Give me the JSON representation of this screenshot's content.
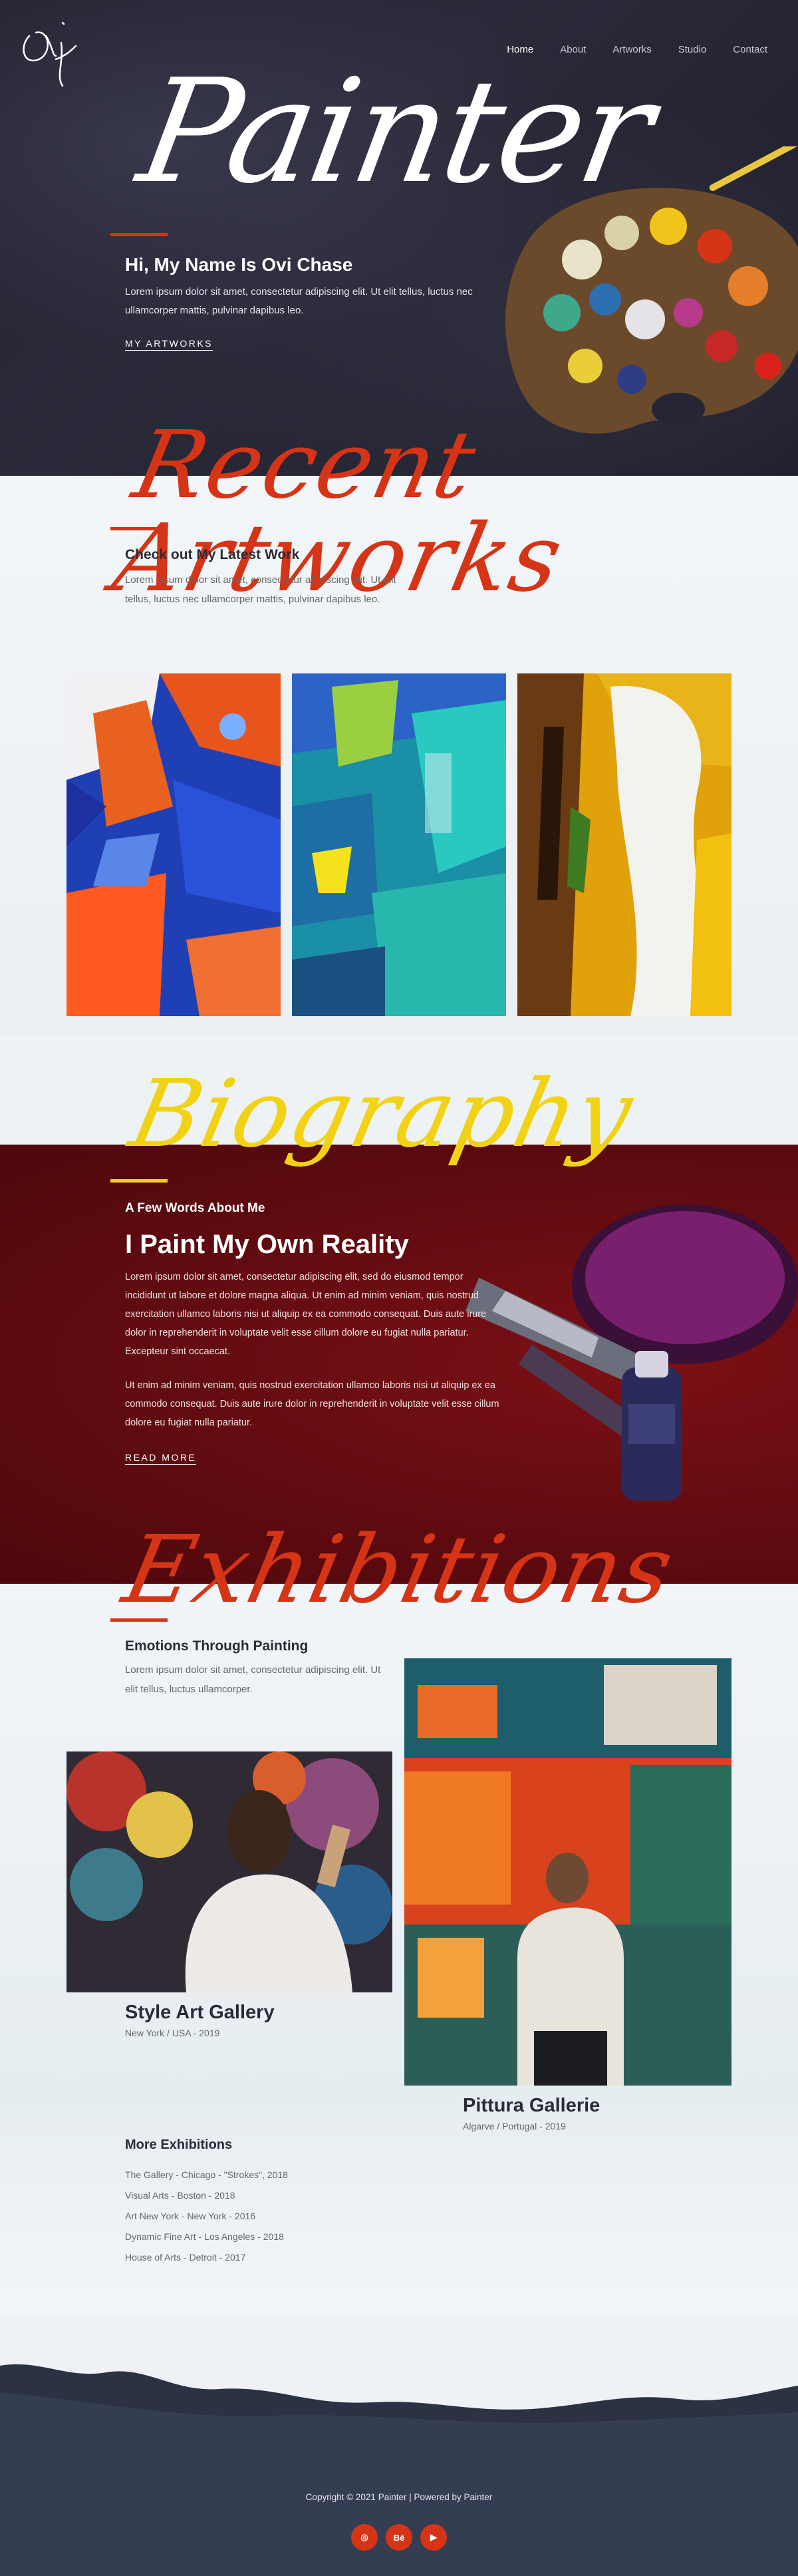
{
  "nav": {
    "items": [
      {
        "label": "Home",
        "active": true
      },
      {
        "label": "About",
        "active": false
      },
      {
        "label": "Artworks",
        "active": false
      },
      {
        "label": "Studio",
        "active": false
      },
      {
        "label": "Contact",
        "active": false
      }
    ]
  },
  "hero": {
    "script_title": "Painter",
    "greeting": "Hi, My Name Is Ovi Chase",
    "text": "Lorem ipsum dolor sit amet, consectetur adipiscing elit. Ut elit tellus, luctus nec ullamcorper mattis, pulvinar dapibus leo.",
    "link_label": "MY ARTWORKS"
  },
  "recent": {
    "script_title": "Recent Artworks",
    "subtitle": "Check out My Latest Work",
    "text": "Lorem ipsum dolor sit amet, consectetur adipiscing elit. Ut elit tellus, luctus nec ullamcorper mattis, pulvinar dapibus leo."
  },
  "biography": {
    "script_title": "Biography",
    "subtitle": "A Few Words About Me",
    "title": "I Paint My Own Reality",
    "paragraph1": "Lorem ipsum dolor sit amet, consectetur adipiscing elit, sed do eiusmod tempor incididunt ut labore et dolore magna aliqua. Ut enim ad minim veniam, quis nostrud exercitation ullamco laboris nisi ut aliquip ex ea commodo consequat. Duis aute irure dolor in reprehenderit in voluptate velit esse cillum dolore eu fugiat nulla pariatur. Excepteur sint occaecat.",
    "paragraph2": "Ut enim ad minim veniam, quis nostrud exercitation ullamco laboris nisi ut aliquip ex ea commodo consequat. Duis aute irure dolor in reprehenderit in voluptate velit esse cillum dolore eu fugiat nulla pariatur.",
    "link_label": "READ MORE"
  },
  "exhibitions": {
    "script_title": "Exhibitions",
    "subtitle": "Emotions Through Painting",
    "text": "Lorem ipsum dolor sit amet, consectetur adipiscing elit. Ut elit tellus, luctus ullamcorper.",
    "gallery1": {
      "name": "Style Art Gallery",
      "location": "New York / USA - 2019"
    },
    "gallery2": {
      "name": "Pittura Gallerie",
      "location": "Algarve / Portugal - 2019"
    },
    "more_title": "More Exhibitions",
    "more_items": [
      "The Gallery - Chicago - \"Strokes\", 2018",
      "Visual Arts - Boston - 2018",
      "Art New York - New York - 2016",
      "Dynamic Fine Art - Los Angeles - 2018",
      "House of Arts - Detroit - 2017"
    ]
  },
  "footer": {
    "copyright": "Copyright © 2021 Painter | Powered by Painter",
    "social": [
      {
        "icon": "dribbble-icon",
        "glyph": "◎"
      },
      {
        "icon": "behance-icon",
        "glyph": "Bē"
      },
      {
        "icon": "youtube-icon",
        "glyph": "▶"
      }
    ]
  },
  "colors": {
    "accent": "#d63416",
    "bio_accent": "#f2d215",
    "bio_bg": "#5e0b10",
    "hero_bg": "#22212e"
  }
}
